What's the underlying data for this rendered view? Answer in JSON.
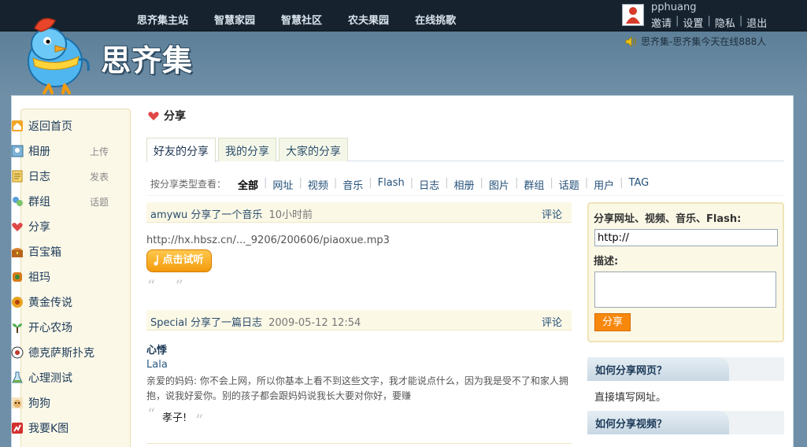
{
  "topnav": [
    "思齐集主站",
    "智慧家园",
    "智慧社区",
    "农夫果园",
    "在线挑歌"
  ],
  "logo_text": "思齐集",
  "user": {
    "name": "pphuang",
    "links": [
      "邀请",
      "设置",
      "隐私",
      "退出"
    ]
  },
  "notice": "思齐集-思齐集今天在线888人",
  "sidebar": {
    "items": [
      {
        "label": "返回首页",
        "extra": "",
        "icon": "home-icon"
      },
      {
        "label": "相册",
        "extra": "上传",
        "icon": "album-icon"
      },
      {
        "label": "日志",
        "extra": "发表",
        "icon": "blog-icon"
      },
      {
        "label": "群组",
        "extra": "话题",
        "icon": "group-icon"
      },
      {
        "label": "分享",
        "extra": "",
        "icon": "share-icon"
      },
      {
        "label": "百宝箱",
        "extra": "",
        "icon": "treasure-box-icon"
      },
      {
        "label": "祖玛",
        "extra": "",
        "icon": "zuma-icon"
      },
      {
        "label": "黄金传说",
        "extra": "",
        "icon": "gold-legend-icon"
      },
      {
        "label": "开心农场",
        "extra": "",
        "icon": "farm-icon"
      },
      {
        "label": "德克萨斯扑克",
        "extra": "",
        "icon": "poker-icon"
      },
      {
        "label": "心理测试",
        "extra": "",
        "icon": "test-flask-icon"
      },
      {
        "label": "狗狗",
        "extra": "",
        "icon": "dog-icon"
      },
      {
        "label": "我要K图",
        "extra": "",
        "icon": "k-chart-icon"
      }
    ]
  },
  "main": {
    "title": "分享",
    "tabs": [
      "好友的分享",
      "我的分享",
      "大家的分享"
    ],
    "filter_label": "按分享类型查看：",
    "filters": [
      "全部",
      "网址",
      "视频",
      "音乐",
      "Flash",
      "日志",
      "相册",
      "图片",
      "群组",
      "话题",
      "用户",
      "TAG"
    ],
    "feed": [
      {
        "actor": "amywu",
        "action": "分享了一个音乐",
        "time": "10小时前",
        "comment_label": "评论",
        "url": "http://hx.hbsz.cn/..._9206/200606/piaoxue.mp3",
        "listen_label": "点击试听"
      },
      {
        "actor": "Special",
        "action": "分享了一篇日志",
        "time": "2009-05-12 12:54",
        "comment_label": "评论",
        "blog_title": "心悸",
        "author": "Lala",
        "body": "亲爱的妈妈: 你不会上网，所以你基本上看不到这些文字，我才能说点什么，因为我是受不了和家人拥抱，说我好爱你。别的孩子都会跟妈妈说我长大要对你好，要赚",
        "quote": "孝子!"
      }
    ]
  },
  "share_box": {
    "url_label": "分享网址、视频、音乐、Flash:",
    "url_value": "http://",
    "desc_label": "描述:",
    "submit_label": "分享"
  },
  "help": [
    {
      "title": "如何分享网页？",
      "text": "直接填写网址。"
    },
    {
      "title": "如何分享视频？",
      "text": ""
    }
  ],
  "colors": {
    "topbar": "#16222e",
    "header": "#6f8fa8",
    "accent_orange": "#f7880c",
    "sidebar_bg": "#fbf8e8",
    "link": "#24507a"
  }
}
